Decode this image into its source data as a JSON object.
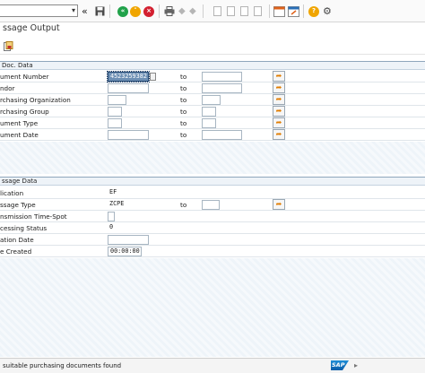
{
  "title": "ssage Output",
  "sections": {
    "doc": "Doc. Data",
    "msg": "ssage Data"
  },
  "doc_fields": [
    {
      "label": "ument Number",
      "value": "4523259382"
    },
    {
      "label": "ndor",
      "value": ""
    },
    {
      "label": "rchasing Organization",
      "value": ""
    },
    {
      "label": "rchasing Group",
      "value": ""
    },
    {
      "label": "ument Type",
      "value": ""
    },
    {
      "label": "ument Date",
      "value": ""
    }
  ],
  "to_label": "to",
  "msg_fields": [
    {
      "label": "lication",
      "value": "EF"
    },
    {
      "label": "ssage Type",
      "value": "ZCPE"
    },
    {
      "label": "nsmission Time-Spot",
      "value": ""
    },
    {
      "label": "cessing Status",
      "value": "0"
    },
    {
      "label": "ation Date",
      "value": ""
    },
    {
      "label": "e Created",
      "value": "00:00:00"
    }
  ],
  "status_message": "suitable purchasing documents found",
  "logo": "SAP",
  "icons": {
    "back": "double-chevron-left-icon",
    "save": "save-icon",
    "green": "back-green-icon",
    "yellow": "exit-yellow-icon",
    "red": "cancel-red-icon",
    "help": "help-icon",
    "settings": "settings-icon",
    "execute": "execute-icon"
  },
  "colors": {
    "green": "#21a24a",
    "yellow": "#f0a500",
    "red": "#d32030",
    "focus_field": "#6d8fb4",
    "section_bg": "#eef3f8"
  }
}
